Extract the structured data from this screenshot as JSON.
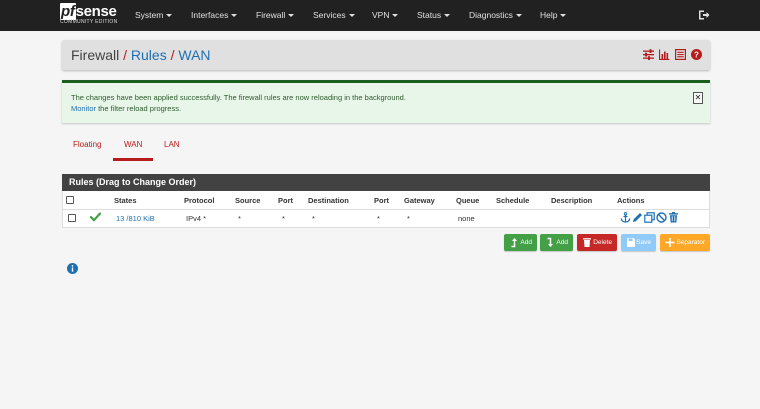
{
  "navbar": {
    "brand_main": "sense",
    "brand_pf": "pf",
    "brand_sub": "COMMUNITY EDITION",
    "menu": [
      "System",
      "Interfaces",
      "Firewall",
      "Services",
      "VPN",
      "Status",
      "Diagnostics",
      "Help"
    ]
  },
  "breadcrumb": {
    "root": "Firewall",
    "sep": "/",
    "rules": "Rules",
    "current": "WAN"
  },
  "alert": {
    "line1": "The changes have been applied successfully. The firewall rules are now reloading in the background.",
    "monitor_link": "Monitor",
    "line2_rest": " the filter reload progress.",
    "close": "✕"
  },
  "tabs": [
    "Floating",
    "WAN",
    "LAN"
  ],
  "rules_panel": {
    "title": "Rules (Drag to Change Order)",
    "headers": [
      "States",
      "Protocol",
      "Source",
      "Port",
      "Destination",
      "Port",
      "Gateway",
      "Queue",
      "Schedule",
      "Description",
      "Actions"
    ],
    "row": {
      "states": "13 /810 KiB",
      "protocol": "IPv4 *",
      "source": "*",
      "source_port": "*",
      "destination": "*",
      "dest_port": "*",
      "gateway": "*",
      "queue": "none",
      "schedule": "",
      "description": ""
    }
  },
  "buttons": {
    "add_top": "Add",
    "add_bottom": "Add",
    "delete": "Delete",
    "save": "Save",
    "separator": "Separator"
  },
  "colors": {
    "navbar": "#212121",
    "accent_red": "#b71c1c",
    "link_blue": "#1e70b3",
    "success_green": "#43a047",
    "delete_red": "#c62828",
    "save_blue": "#90caf9",
    "separator_orange": "#ffa726"
  }
}
